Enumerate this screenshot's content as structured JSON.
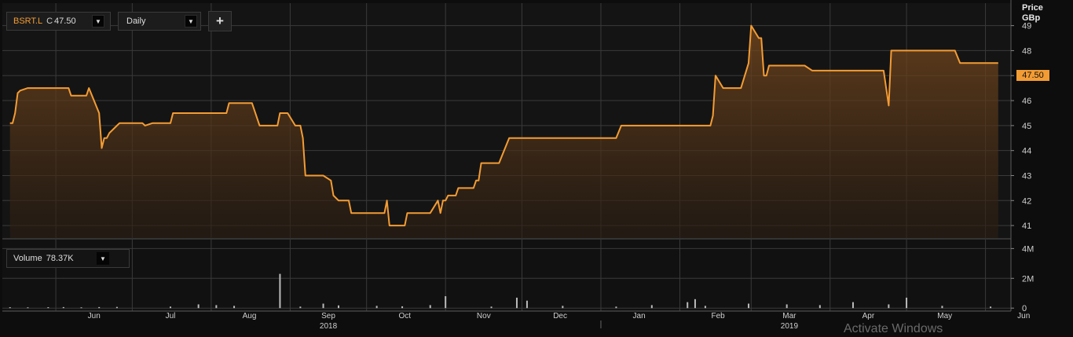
{
  "header": {
    "symbol": "BSRT.L",
    "close_label": "C",
    "close_value": "47.50",
    "interval": "Daily",
    "add_label": "+",
    "caret": "▼"
  },
  "price_axis": {
    "title": "Price",
    "unit": "GBp",
    "last_value_tag": "47.50"
  },
  "volume_panel": {
    "label": "Volume",
    "value": "78.37K"
  },
  "watermark": "Activate Windows",
  "colors": {
    "line": "#f39c34",
    "last_tag_bg": "#f39c34",
    "volume_bar": "#bbbbbb",
    "background": "#141414",
    "grid": "#3a3a3a"
  },
  "chart_data": [
    {
      "type": "area",
      "series": [
        {
          "name": "BSRT.L",
          "points": [
            [
              "2018-05-14",
              45.1
            ],
            [
              "2018-05-15",
              45.1
            ],
            [
              "2018-05-16",
              45.5
            ],
            [
              "2018-05-17",
              46.3
            ],
            [
              "2018-05-18",
              46.4
            ],
            [
              "2018-05-21",
              46.5
            ],
            [
              "2018-05-25",
              46.5
            ],
            [
              "2018-05-30",
              46.5
            ],
            [
              "2018-06-01",
              46.5
            ],
            [
              "2018-06-04",
              46.5
            ],
            [
              "2018-06-06",
              46.5
            ],
            [
              "2018-06-07",
              46.2
            ],
            [
              "2018-06-11",
              46.2
            ],
            [
              "2018-06-13",
              46.2
            ],
            [
              "2018-06-14",
              46.5
            ],
            [
              "2018-06-18",
              45.5
            ],
            [
              "2018-06-19",
              44.1
            ],
            [
              "2018-06-20",
              44.5
            ],
            [
              "2018-06-21",
              44.5
            ],
            [
              "2018-06-22",
              44.7
            ],
            [
              "2018-06-25",
              45.0
            ],
            [
              "2018-06-26",
              45.1
            ],
            [
              "2018-07-02",
              45.1
            ],
            [
              "2018-07-05",
              45.1
            ],
            [
              "2018-07-06",
              45.0
            ],
            [
              "2018-07-09",
              45.1
            ],
            [
              "2018-07-12",
              45.1
            ],
            [
              "2018-07-16",
              45.1
            ],
            [
              "2018-07-17",
              45.5
            ],
            [
              "2018-07-20",
              45.5
            ],
            [
              "2018-07-26",
              45.5
            ],
            [
              "2018-08-02",
              45.5
            ],
            [
              "2018-08-06",
              45.5
            ],
            [
              "2018-08-07",
              45.5
            ],
            [
              "2018-08-08",
              45.9
            ],
            [
              "2018-08-13",
              45.9
            ],
            [
              "2018-08-16",
              45.9
            ],
            [
              "2018-08-17",
              45.9
            ],
            [
              "2018-08-20",
              45.0
            ],
            [
              "2018-08-27",
              45.0
            ],
            [
              "2018-08-28",
              45.5
            ],
            [
              "2018-08-30",
              45.5
            ],
            [
              "2018-08-31",
              45.5
            ],
            [
              "2018-09-03",
              45.0
            ],
            [
              "2018-09-05",
              45.0
            ],
            [
              "2018-09-06",
              44.5
            ],
            [
              "2018-09-07",
              43.0
            ],
            [
              "2018-09-12",
              43.0
            ],
            [
              "2018-09-14",
              43.0
            ],
            [
              "2018-09-17",
              42.8
            ],
            [
              "2018-09-18",
              42.2
            ],
            [
              "2018-09-20",
              42.0
            ],
            [
              "2018-09-24",
              42.0
            ],
            [
              "2018-09-25",
              41.5
            ],
            [
              "2018-09-28",
              41.5
            ],
            [
              "2018-10-03",
              41.5
            ],
            [
              "2018-10-08",
              41.5
            ],
            [
              "2018-10-09",
              42.0
            ],
            [
              "2018-10-10",
              41.0
            ],
            [
              "2018-10-15",
              41.0
            ],
            [
              "2018-10-16",
              41.0
            ],
            [
              "2018-10-17",
              41.5
            ],
            [
              "2018-10-26",
              41.5
            ],
            [
              "2018-10-29",
              42.0
            ],
            [
              "2018-10-30",
              41.5
            ],
            [
              "2018-10-31",
              42.0
            ],
            [
              "2018-11-01",
              42.0
            ],
            [
              "2018-11-02",
              42.2
            ],
            [
              "2018-11-05",
              42.2
            ],
            [
              "2018-11-06",
              42.5
            ],
            [
              "2018-11-09",
              42.5
            ],
            [
              "2018-11-12",
              42.5
            ],
            [
              "2018-11-13",
              42.8
            ],
            [
              "2018-11-14",
              42.8
            ],
            [
              "2018-11-15",
              43.5
            ],
            [
              "2018-11-19",
              43.5
            ],
            [
              "2018-11-22",
              43.5
            ],
            [
              "2018-11-26",
              44.5
            ],
            [
              "2018-12-10",
              44.5
            ],
            [
              "2018-12-31",
              44.5
            ],
            [
              "2019-01-07",
              44.5
            ],
            [
              "2019-01-09",
              45.0
            ],
            [
              "2019-01-21",
              45.0
            ],
            [
              "2019-02-04",
              45.0
            ],
            [
              "2019-02-11",
              45.0
            ],
            [
              "2019-02-13",
              45.0
            ],
            [
              "2019-02-14",
              45.4
            ],
            [
              "2019-02-15",
              47.0
            ],
            [
              "2019-02-18",
              46.5
            ],
            [
              "2019-02-25",
              46.5
            ],
            [
              "2019-02-28",
              47.5
            ],
            [
              "2019-03-01",
              49.0
            ],
            [
              "2019-03-04",
              48.5
            ],
            [
              "2019-03-05",
              48.5
            ],
            [
              "2019-03-06",
              47.0
            ],
            [
              "2019-03-07",
              47.0
            ],
            [
              "2019-03-08",
              47.4
            ],
            [
              "2019-03-15",
              47.4
            ],
            [
              "2019-03-22",
              47.4
            ],
            [
              "2019-03-25",
              47.2
            ],
            [
              "2019-04-01",
              47.2
            ],
            [
              "2019-04-15",
              47.2
            ],
            [
              "2019-04-22",
              47.2
            ],
            [
              "2019-04-24",
              45.8
            ],
            [
              "2019-04-25",
              48.0
            ],
            [
              "2019-05-10",
              48.0
            ],
            [
              "2019-05-20",
              48.0
            ],
            [
              "2019-05-22",
              47.5
            ],
            [
              "2019-06-06",
              47.5
            ]
          ]
        }
      ],
      "y_axis": {
        "ticks": [
          41,
          42,
          43,
          44,
          45,
          46,
          47,
          48,
          49
        ],
        "ylim": [
          40.5,
          49.9
        ]
      },
      "x_axis": {
        "ticks": [
          {
            "label": "Jun",
            "date": "2018-06-01"
          },
          {
            "label": "Jul",
            "date": "2018-07-01"
          },
          {
            "label": "Aug",
            "date": "2018-08-01"
          },
          {
            "label": "Sep",
            "date": "2018-09-01",
            "year": "2018"
          },
          {
            "label": "Oct",
            "date": "2018-10-01"
          },
          {
            "label": "Nov",
            "date": "2018-11-01"
          },
          {
            "label": "Dec",
            "date": "2018-12-01"
          },
          {
            "label": "Jan",
            "date": "2019-01-01"
          },
          {
            "label": "Feb",
            "date": "2019-02-01"
          },
          {
            "label": "Mar",
            "date": "2019-03-01",
            "year": "2019"
          },
          {
            "label": "Apr",
            "date": "2019-04-01"
          },
          {
            "label": "May",
            "date": "2019-05-01"
          },
          {
            "label": "Jun",
            "date": "2019-06-01"
          }
        ],
        "xlim": [
          "2018-05-11",
          "2019-06-11"
        ]
      },
      "grid": true,
      "legend": "none"
    },
    {
      "type": "bar",
      "series": [
        {
          "name": "Volume",
          "points": [
            [
              "2018-05-14",
              0.06
            ],
            [
              "2018-05-21",
              0.05
            ],
            [
              "2018-05-29",
              0.06
            ],
            [
              "2018-06-04",
              0.07
            ],
            [
              "2018-06-11",
              0.05
            ],
            [
              "2018-06-18",
              0.07
            ],
            [
              "2018-06-25",
              0.08
            ],
            [
              "2018-07-16",
              0.1
            ],
            [
              "2018-07-27",
              0.25
            ],
            [
              "2018-08-03",
              0.2
            ],
            [
              "2018-08-10",
              0.15
            ],
            [
              "2018-08-28",
              2.3
            ],
            [
              "2018-09-05",
              0.1
            ],
            [
              "2018-09-14",
              0.3
            ],
            [
              "2018-09-20",
              0.18
            ],
            [
              "2018-10-05",
              0.15
            ],
            [
              "2018-10-15",
              0.12
            ],
            [
              "2018-10-26",
              0.2
            ],
            [
              "2018-11-01",
              0.8
            ],
            [
              "2018-11-19",
              0.1
            ],
            [
              "2018-11-29",
              0.7
            ],
            [
              "2018-12-03",
              0.5
            ],
            [
              "2018-12-17",
              0.15
            ],
            [
              "2019-01-07",
              0.1
            ],
            [
              "2019-01-21",
              0.2
            ],
            [
              "2019-02-04",
              0.4
            ],
            [
              "2019-02-07",
              0.6
            ],
            [
              "2019-02-11",
              0.15
            ],
            [
              "2019-02-28",
              0.3
            ],
            [
              "2019-03-15",
              0.25
            ],
            [
              "2019-03-28",
              0.2
            ],
            [
              "2019-04-10",
              0.4
            ],
            [
              "2019-04-24",
              0.25
            ],
            [
              "2019-05-01",
              0.7
            ],
            [
              "2019-05-15",
              0.15
            ],
            [
              "2019-06-03",
              0.1
            ]
          ]
        }
      ],
      "y_axis": {
        "ticks": [
          {
            "value": 0,
            "label": "0"
          },
          {
            "value": 2,
            "label": "2M"
          },
          {
            "value": 4,
            "label": "4M"
          }
        ],
        "ylim": [
          -0.2,
          4.6
        ]
      },
      "grid": true,
      "legend": "none"
    }
  ]
}
